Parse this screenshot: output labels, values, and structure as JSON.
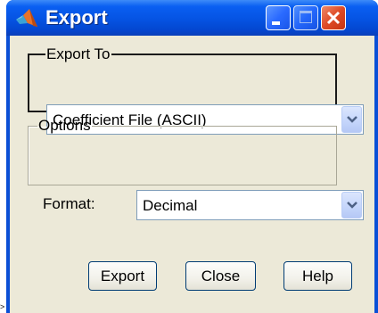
{
  "artifact": ">",
  "window": {
    "title": "Export",
    "icon": "matlab-icon",
    "buttons": [
      "minimize-icon",
      "maximize-icon",
      "close-icon"
    ]
  },
  "export_to": {
    "legend": "Export To",
    "selected": "Coefficient File (ASCII)"
  },
  "options": {
    "legend": "Options",
    "format_label": "Format:",
    "format_selected": "Decimal"
  },
  "buttons": {
    "export": "Export",
    "close": "Close",
    "help": "Help"
  },
  "colors": {
    "titlebar": "#0553e2",
    "client": "#ece9d8",
    "close_button": "#de4a25"
  }
}
